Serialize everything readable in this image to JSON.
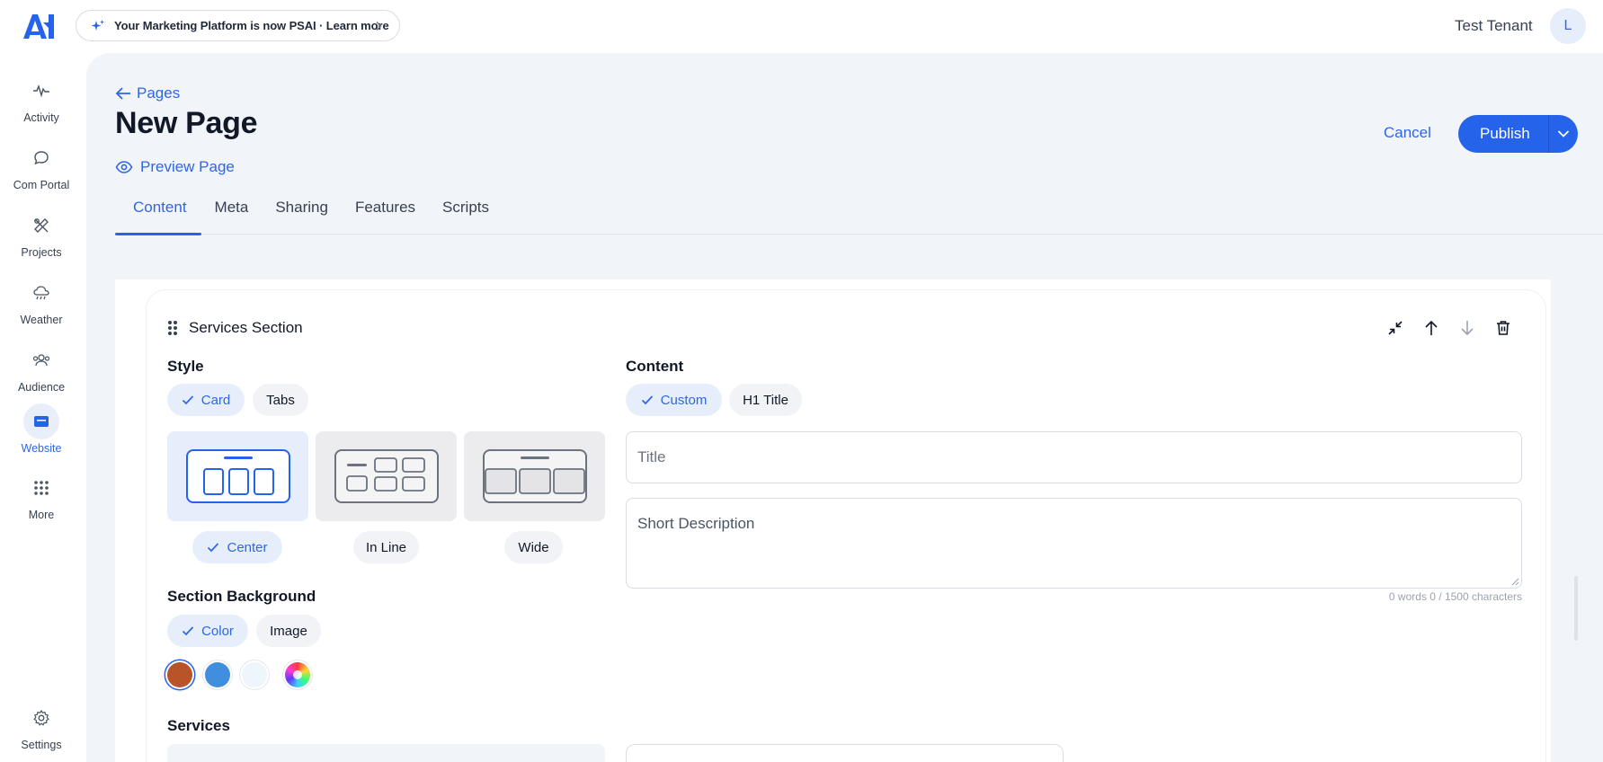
{
  "banner": {
    "text": "Your Marketing Platform is now PSAI · Learn more"
  },
  "user": {
    "tenant": "Test Tenant",
    "avatar_initial": "L"
  },
  "sidebar": {
    "items": [
      {
        "label": "Activity",
        "icon": "activity-icon"
      },
      {
        "label": "Com Portal",
        "icon": "chat-icon"
      },
      {
        "label": "Projects",
        "icon": "tools-icon"
      },
      {
        "label": "Weather",
        "icon": "weather-icon"
      },
      {
        "label": "Audience",
        "icon": "audience-icon"
      },
      {
        "label": "Website",
        "icon": "website-icon",
        "active": true
      },
      {
        "label": "More",
        "icon": "grid-icon"
      }
    ],
    "settings": {
      "label": "Settings",
      "icon": "gear-icon"
    }
  },
  "header": {
    "back_label": "Pages",
    "title": "New Page",
    "preview_label": "Preview Page",
    "cancel_label": "Cancel",
    "publish_label": "Publish"
  },
  "tabs": [
    {
      "label": "Content",
      "active": true
    },
    {
      "label": "Meta"
    },
    {
      "label": "Sharing"
    },
    {
      "label": "Features"
    },
    {
      "label": "Scripts"
    }
  ],
  "section": {
    "title": "Services Section",
    "style": {
      "heading": "Style",
      "options": [
        {
          "label": "Card",
          "selected": true
        },
        {
          "label": "Tabs"
        }
      ],
      "layouts": [
        {
          "label": "Center",
          "selected": true
        },
        {
          "label": "In Line"
        },
        {
          "label": "Wide"
        }
      ]
    },
    "background": {
      "heading": "Section Background",
      "options": [
        {
          "label": "Color",
          "selected": true
        },
        {
          "label": "Image"
        }
      ],
      "swatches": [
        "#b85428",
        "#3f8fde",
        "#eef5fb",
        "color-wheel"
      ]
    },
    "content": {
      "heading": "Content",
      "options": [
        {
          "label": "Custom",
          "selected": true
        },
        {
          "label": "H1 Title"
        }
      ],
      "title_placeholder": "Title",
      "description_placeholder": "Short Description",
      "counter": "0 words 0 / 1500 characters"
    },
    "services_heading": "Services"
  },
  "colors": {
    "accent": "#2563eb",
    "accent_text": "#2f66e6",
    "panel_bg": "#f1f4f9"
  }
}
